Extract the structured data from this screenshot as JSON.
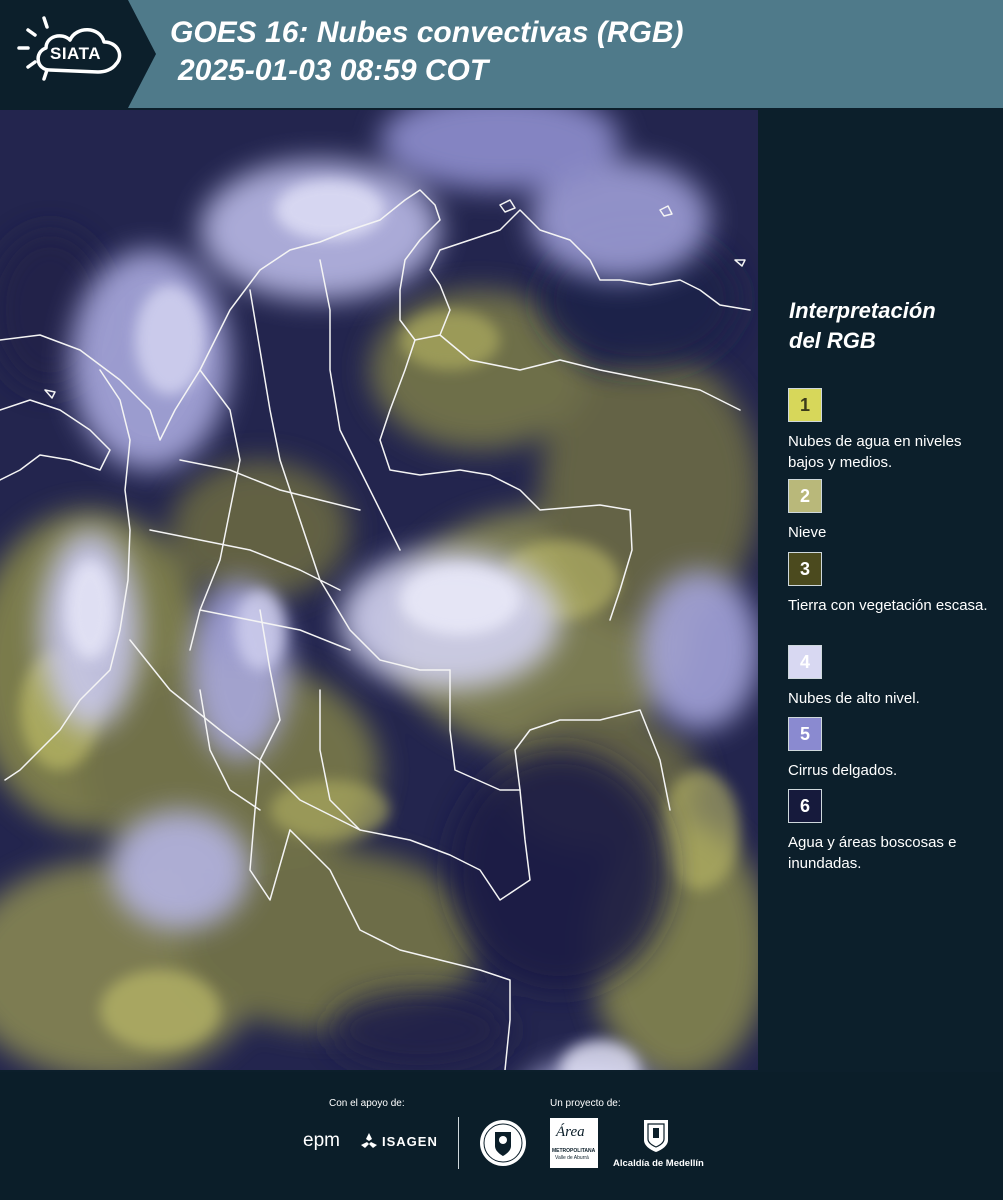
{
  "header": {
    "logo_text": "SIATA",
    "title_line1": "GOES 16: Nubes convectivas (RGB)",
    "title_line2": "2025-01-03 08:59 COT"
  },
  "legend": {
    "title_line1": "Interpretación",
    "title_line2": "del RGB",
    "items": [
      {
        "number": "1",
        "color": "#d7d75a",
        "text_color": "#3a3a1a",
        "label": "Nubes de agua en niveles bajos y medios."
      },
      {
        "number": "2",
        "color": "#b9b87a",
        "text_color": "#ffffff",
        "label": "Nieve"
      },
      {
        "number": "3",
        "color": "#4b4a1e",
        "text_color": "#ffffff",
        "label": "Tierra con vegetación escasa."
      },
      {
        "number": "4",
        "color": "#d8d8f2",
        "text_color": "#ffffff",
        "label": "Nubes de alto nivel."
      },
      {
        "number": "5",
        "color": "#8a8ad0",
        "text_color": "#ffffff",
        "label": "Cirrus delgados."
      },
      {
        "number": "6",
        "color": "#161a3c",
        "text_color": "#ffffff",
        "label": "Agua y áreas boscosas e inundadas."
      }
    ]
  },
  "footer": {
    "support_caption": "Con el apoyo de:",
    "project_caption": "Un proyecto de:",
    "epm_text": "epm",
    "isagen_text": "ISAGEN",
    "area_text": "Área",
    "area_subtext": "METROPOLITANA",
    "area_subtext2": "Valle de Aburrá",
    "alcaldia_text": "Alcaldía de Medellín"
  },
  "colors": {
    "header_bg": "#4f7a8a",
    "page_bg": "#0c1f2b",
    "map_water": "#24264f"
  }
}
